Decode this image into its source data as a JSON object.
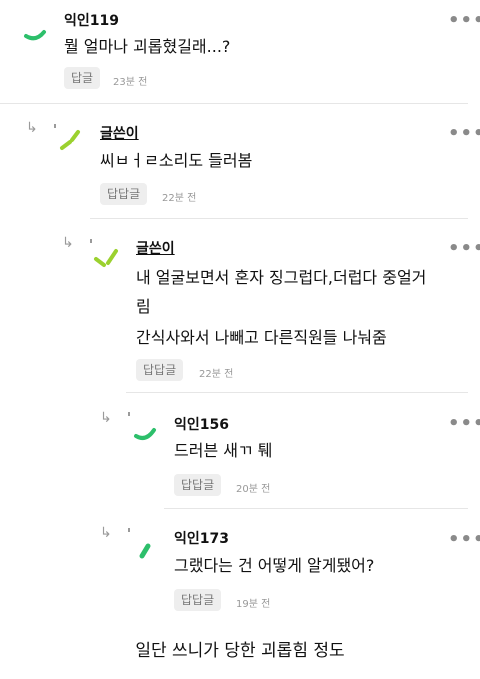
{
  "comments": [
    {
      "author": "익인119",
      "body": [
        "뭘 얼마나 괴롭혔길래...?"
      ],
      "reply_label": "답글",
      "time": "23분 전",
      "more": "•••"
    },
    {
      "author": "글쓴이",
      "body": [
        "씨ㅂㅓㄹ소리도 들러봄"
      ],
      "reply_label": "답답글",
      "time": "22분 전",
      "more": "•••"
    },
    {
      "author": "글쓴이",
      "body": [
        "내 얼굴보면서 혼자 징그럽다,더럽다 중얼거",
        "림",
        "간식사와서 나빼고 다른직원들 나눠줌"
      ],
      "reply_label": "답답글",
      "time": "22분 전",
      "more": "•••"
    },
    {
      "author": "익인156",
      "body": [
        "드러븐 새ㄲ 퉤"
      ],
      "reply_label": "답답글",
      "time": "20분 전",
      "more": "•••"
    },
    {
      "author": "익인173",
      "body": [
        "그랬다는 건 어떻게 알게됐어?"
      ],
      "reply_label": "답답글",
      "time": "19분 전",
      "more": "•••"
    }
  ],
  "reply_arrow_icon": "↳",
  "caption": "일단 쓰니가 당한 괴롭힘 정도",
  "colors": {
    "avatar_green": "#2dbf6b",
    "avatar_lime": "#9bd12f",
    "avatar_gray": "#9a9a9a"
  }
}
